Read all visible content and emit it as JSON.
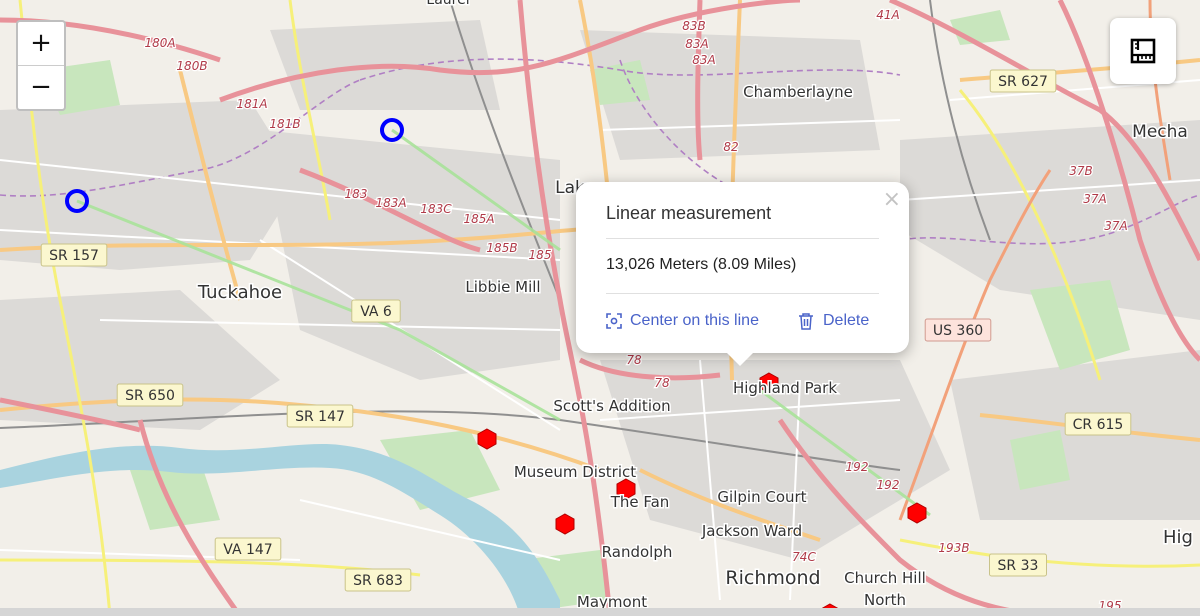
{
  "map": {
    "place_labels": [
      {
        "text": "Laurel"
      },
      {
        "text": "Chamberlayne"
      },
      {
        "text": "Mecha"
      },
      {
        "text": "Lak"
      },
      {
        "text": "Tuckahoe"
      },
      {
        "text": "Libbie Mill"
      },
      {
        "text": "Highland Park"
      },
      {
        "text": "Scott's Addition"
      },
      {
        "text": "Museum District"
      },
      {
        "text": "The Fan"
      },
      {
        "text": "Gilpin Court"
      },
      {
        "text": "Jackson Ward"
      },
      {
        "text": "Randolph"
      },
      {
        "text": "Richmond"
      },
      {
        "text": "Church Hill"
      },
      {
        "text": "North"
      },
      {
        "text": "Maymont"
      },
      {
        "text": "Hig"
      }
    ],
    "route_shields": [
      {
        "text": "SR 627"
      },
      {
        "text": "SR 157"
      },
      {
        "text": "VA 6"
      },
      {
        "text": "US 360"
      },
      {
        "text": "SR 650"
      },
      {
        "text": "SR 147"
      },
      {
        "text": "CR 615"
      },
      {
        "text": "VA 147"
      },
      {
        "text": "SR 683"
      },
      {
        "text": "SR 33"
      }
    ],
    "exit_labels": [
      {
        "text": "180A"
      },
      {
        "text": "180B"
      },
      {
        "text": "181A"
      },
      {
        "text": "181B"
      },
      {
        "text": "183"
      },
      {
        "text": "183A"
      },
      {
        "text": "183C"
      },
      {
        "text": "185A"
      },
      {
        "text": "185B"
      },
      {
        "text": "185"
      },
      {
        "text": "83B"
      },
      {
        "text": "83A"
      },
      {
        "text": "83A"
      },
      {
        "text": "82"
      },
      {
        "text": "41A"
      },
      {
        "text": "37B"
      },
      {
        "text": "37A"
      },
      {
        "text": "37A"
      },
      {
        "text": "78"
      },
      {
        "text": "78"
      },
      {
        "text": "192"
      },
      {
        "text": "192"
      },
      {
        "text": "193B"
      },
      {
        "text": "74C"
      },
      {
        "text": "195"
      }
    ]
  },
  "controls": {
    "zoom_in": "+",
    "zoom_out": "−",
    "measure_icon": "ruler-icon"
  },
  "popup": {
    "title": "Linear measurement",
    "value": "13,026 Meters (8.09 Miles)",
    "close": "×",
    "center_label": "Center on this line",
    "center_icon": "center-target-icon",
    "delete_label": "Delete",
    "delete_icon": "trash-icon"
  },
  "markers": {
    "measure_points": 2,
    "hexagon_markers": 6
  },
  "colors": {
    "measure_circle": "#0000ff",
    "hex_marker": "#ff0000",
    "link_text": "#4a63c9",
    "major_road": "#e8929a",
    "secondary_road": "#fbd79d",
    "river": "#a9d3df",
    "park": "#c8e6bd"
  }
}
